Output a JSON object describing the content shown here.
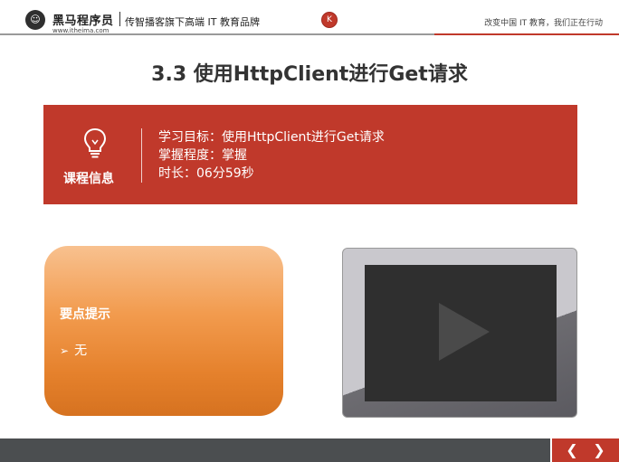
{
  "header": {
    "logo_mark": "☺",
    "logo_name": "黑马程序员",
    "logo_url": "www.itheima.com",
    "tagline": "传智播客旗下高端 IT 教育品牌",
    "badge": "K",
    "slogan": "改变中国 IT 教育，我们正在行动"
  },
  "page_title": "3.3 使用HttpClient进行Get请求",
  "course_info": {
    "label": "课程信息",
    "icon": "lightbulb-icon",
    "lines": [
      "学习目标：使用HttpClient进行Get请求",
      "掌握程度：掌握",
      "时长：06分59秒"
    ]
  },
  "tips": {
    "title": "要点提示",
    "bullet": "➢",
    "items": [
      "无"
    ]
  },
  "video": {
    "icon": "play-icon"
  },
  "footer": {
    "prev": "❮",
    "next": "❯"
  },
  "colors": {
    "accent_red": "#c0392b",
    "tips_orange": "#f29b4e",
    "footer_gray": "#4b4e50"
  }
}
